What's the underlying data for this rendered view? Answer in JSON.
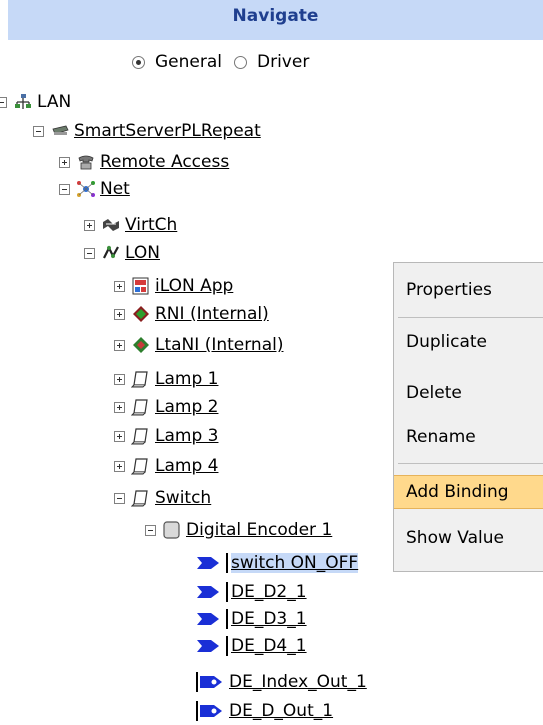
{
  "header": {
    "title": "Navigate"
  },
  "view_mode": {
    "options": [
      "General",
      "Driver"
    ],
    "selected": "General"
  },
  "tree": {
    "lan": "LAN",
    "server": "SmartServerPLRepeat",
    "remote_access": "Remote Access",
    "net": "Net",
    "virtch": "VirtCh",
    "lon": "LON",
    "ilon_app": "iLON App",
    "rni": "RNI (Internal)",
    "ltani": "LtaNI (Internal)",
    "lamp1": "Lamp 1",
    "lamp2": "Lamp 2",
    "lamp3": "Lamp 3",
    "lamp4": "Lamp 4",
    "switch": "Switch",
    "encoder": "Digital Encoder 1",
    "dp1": "switch ON_OFF",
    "dp2": "DE_D2_1",
    "dp3": "DE_D3_1",
    "dp4": "DE_D4_1",
    "dp5": "DE_Index_Out_1",
    "dp6": "DE_D_Out_1"
  },
  "context_menu": {
    "properties": "Properties",
    "duplicate": "Duplicate",
    "delete": "Delete",
    "rename": "Rename",
    "add_binding": "Add Binding",
    "show_value": "Show Value"
  },
  "colors": {
    "header_bg": "#c6d9f7",
    "header_text": "#1f3f8f",
    "menu_highlight": "#ffd98c",
    "datapoint_arrow": "#1a2fd6"
  }
}
